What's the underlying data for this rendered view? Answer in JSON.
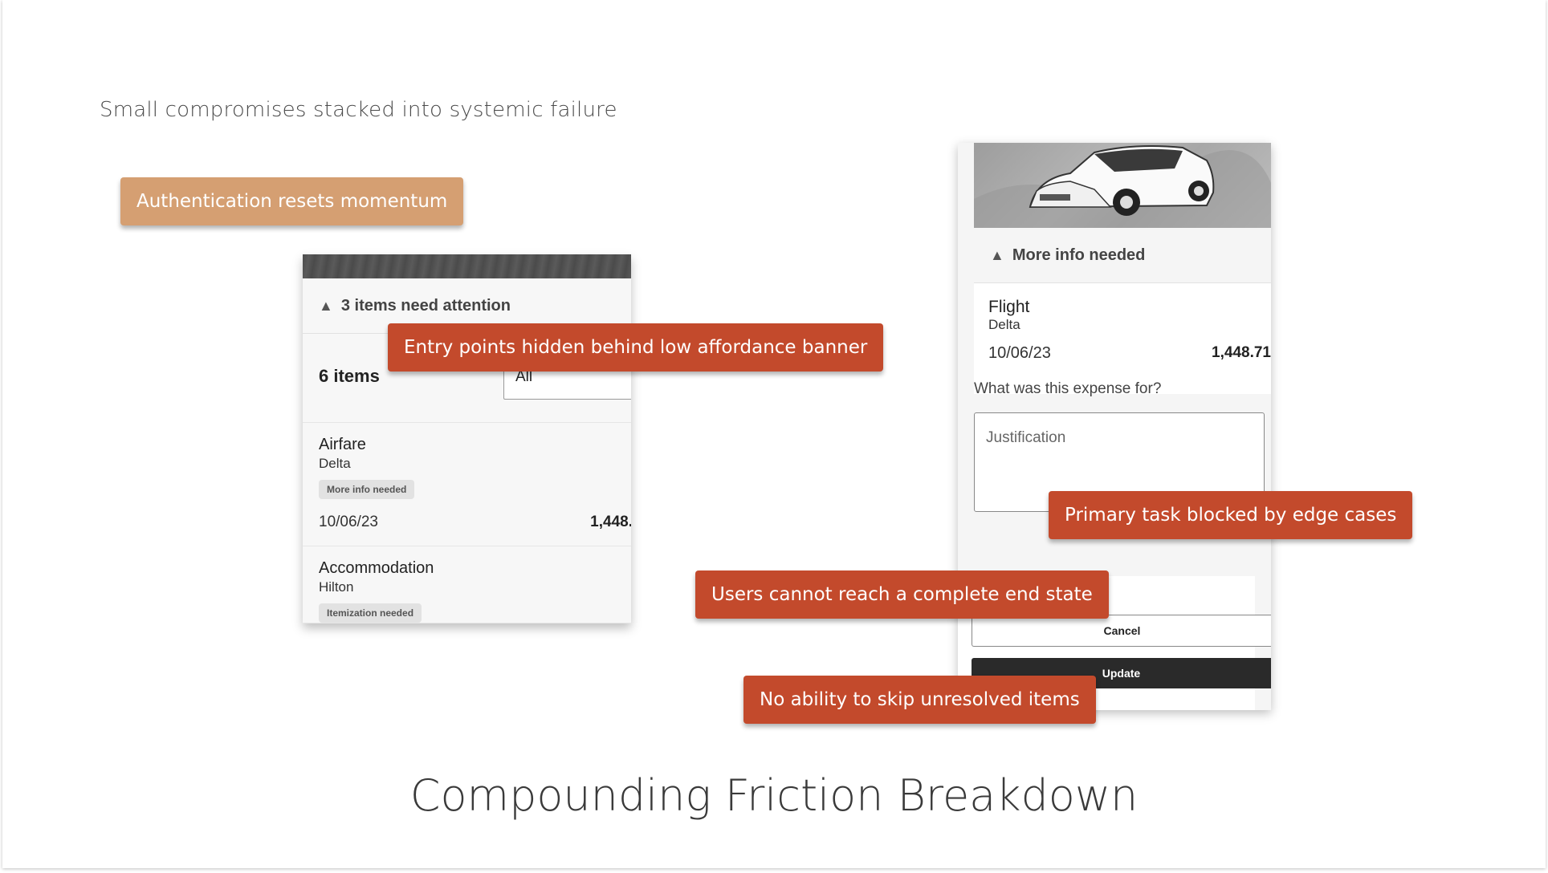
{
  "slide": {
    "subtitle": "Small compromises stacked into systemic failure",
    "title": "Compounding Friction Breakdown"
  },
  "annotations": {
    "auth": "Authentication resets momentum",
    "entry_points": "Entry points hidden behind low affordance banner",
    "primary_task": "Primary task blocked by edge cases",
    "end_state": "Users cannot reach a complete end state",
    "skip": "No ability to skip unresolved items"
  },
  "left_screen": {
    "banner": "3 items need attention",
    "items_count": "6 items",
    "filter_value": "All",
    "expenses": [
      {
        "name": "Airfare",
        "vendor": "Delta",
        "badge": "More info needed",
        "date": "10/06/23",
        "amount": "1,448."
      },
      {
        "name": "Accommodation",
        "vendor": "Hilton",
        "badge": "Itemization needed",
        "date": "",
        "amount": ""
      }
    ]
  },
  "right_screen": {
    "banner": "More info needed",
    "flight": {
      "name": "Flight",
      "vendor": "Delta",
      "date": "10/06/23",
      "amount": "1,448.71"
    },
    "question": "What was this expense for?",
    "justification_placeholder": "Justification",
    "cancel_label": "Cancel",
    "update_label": "Update"
  },
  "colors": {
    "tag_tan": "#d59f72",
    "tag_red": "#c34a2c",
    "update_button": "#2a2a2a"
  }
}
